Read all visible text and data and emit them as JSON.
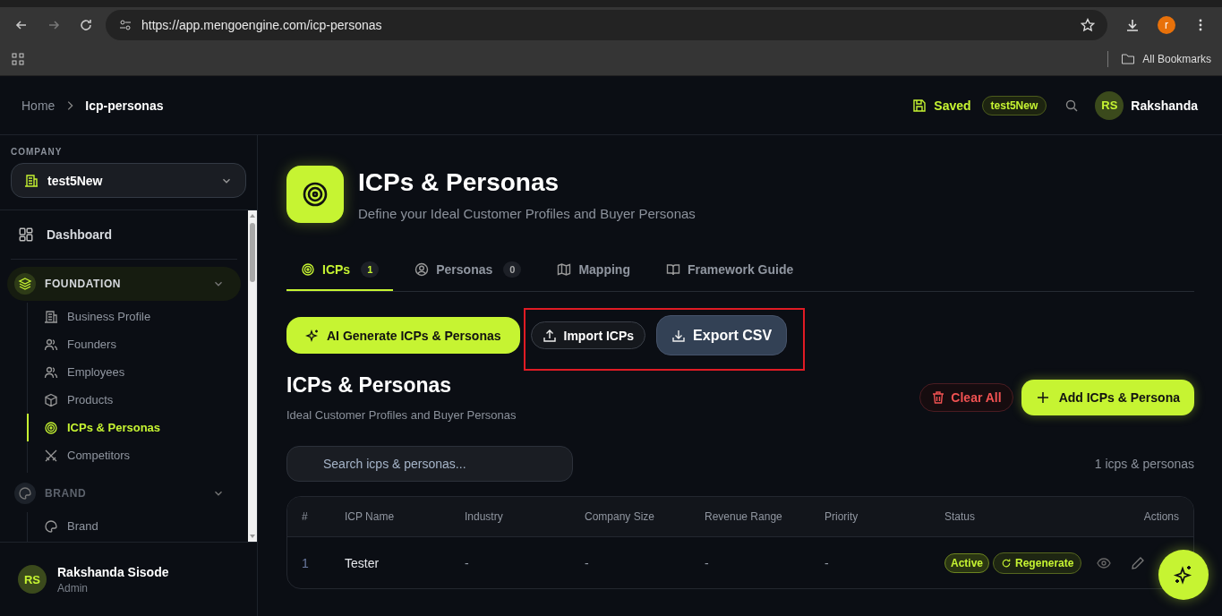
{
  "browser": {
    "url": "https://app.mengoengine.com/icp-personas",
    "profile_initial": "r",
    "bookmarks_label": "All Bookmarks"
  },
  "header": {
    "breadcrumbs": [
      {
        "label": "Home",
        "current": false
      },
      {
        "label": "Icp-personas",
        "current": true
      }
    ],
    "save_status": "Saved",
    "company_badge": "test5New",
    "user_initials": "RS",
    "user_name": "Rakshanda"
  },
  "sidebar": {
    "company_label": "COMPANY",
    "company": "test5New",
    "dashboard": "Dashboard",
    "sections": [
      {
        "title": "FOUNDATION",
        "active": true,
        "expanded": true,
        "items": [
          {
            "label": "Business Profile",
            "selected": false
          },
          {
            "label": "Founders",
            "selected": false
          },
          {
            "label": "Employees",
            "selected": false
          },
          {
            "label": "Products",
            "selected": false
          },
          {
            "label": "ICPs & Personas",
            "selected": true
          },
          {
            "label": "Competitors",
            "selected": false
          }
        ]
      },
      {
        "title": "BRAND",
        "active": false,
        "expanded": true,
        "items": [
          {
            "label": "Brand",
            "selected": false
          }
        ]
      }
    ],
    "user": {
      "initials": "RS",
      "name": "Rakshanda Sisode",
      "role": "Admin"
    }
  },
  "page": {
    "title": "ICPs & Personas",
    "subtitle": "Define your Ideal Customer Profiles and Buyer Personas",
    "tabs": [
      {
        "label": "ICPs",
        "count": "1",
        "selected": true
      },
      {
        "label": "Personas",
        "count": "0",
        "selected": false
      },
      {
        "label": "Mapping",
        "selected": false
      },
      {
        "label": "Framework Guide",
        "selected": false
      }
    ],
    "actions": [
      {
        "label": "AI Generate ICPs & Personas",
        "kind": "primary"
      },
      {
        "label": "Import ICPs",
        "kind": "outline"
      },
      {
        "label": "Export CSV",
        "kind": "secondary"
      }
    ],
    "section_title": "ICPs & Personas",
    "section_subtitle": "Ideal Customer Profiles and Buyer Personas",
    "clear_all": "Clear All",
    "add": "Add ICPs & Persona",
    "search": {
      "placeholder": "Search icps & personas..."
    },
    "count": "1 icps & personas",
    "table": {
      "columns": [
        "#",
        "ICP Name",
        "Industry",
        "Company Size",
        "Revenue Range",
        "Priority",
        "Status",
        "Actions"
      ],
      "rows": [
        {
          "cells": [
            "1",
            "Tester",
            "-",
            "-",
            "-",
            "-"
          ],
          "status": "Active",
          "regenerate": "Regenerate"
        }
      ]
    }
  }
}
